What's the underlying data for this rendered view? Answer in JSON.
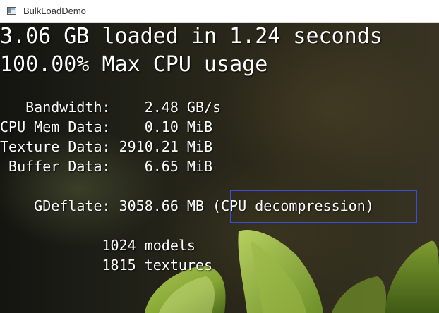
{
  "window": {
    "title": "BulkLoadDemo",
    "icon": "app-window-icon"
  },
  "hud": {
    "headline_loaded": "3.06 GB loaded in 1.24 seconds",
    "headline_cpu": "100.00% Max CPU usage",
    "stats": {
      "bandwidth": "   Bandwidth:    2.48 GB/s",
      "cpu_mem_data": "CPU Mem Data:    0.10 MiB",
      "texture_data": "Texture Data: 2910.21 MiB",
      "buffer_data": " Buffer Data:    6.65 MiB"
    },
    "gdeflate": {
      "label_value": "    GDeflate: 3058.66 MB ",
      "mode": "(CPU decompression)"
    },
    "counts": {
      "models": "            1024 models",
      "textures": "            1815 textures"
    }
  },
  "colors": {
    "highlight_border": "#3b4fd6",
    "text": "#ffffff",
    "leaf_green": "#8fae3a"
  }
}
